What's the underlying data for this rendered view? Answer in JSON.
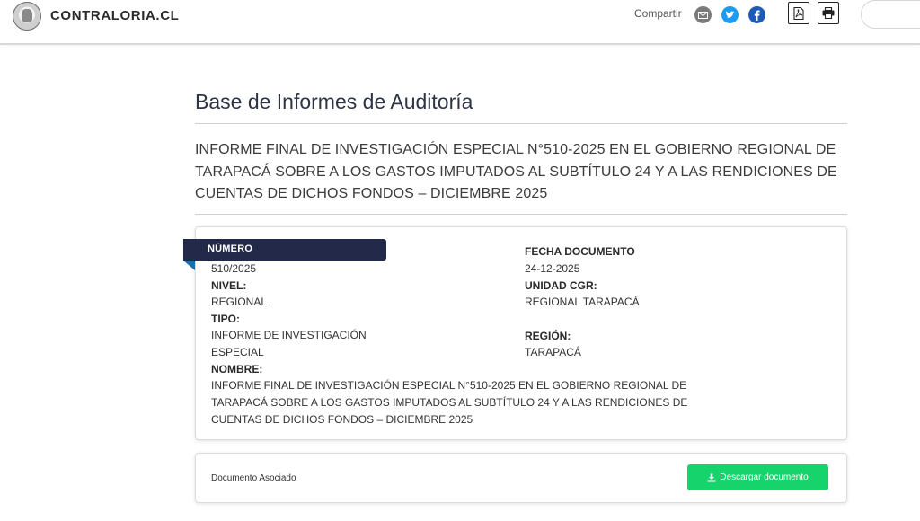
{
  "header": {
    "logo_text": "CONTRALORIA.CL",
    "share_label": "Compartir",
    "share_icons": [
      "mail-icon",
      "twitter-icon",
      "facebook-icon"
    ],
    "tool_icons": [
      "pdf-icon",
      "print-icon"
    ]
  },
  "page": {
    "title": "Base de Informes de Auditoría",
    "report_title": "INFORME FINAL DE INVESTIGACIÓN ESPECIAL N°510-2025 EN EL GOBIERNO REGIONAL DE TARAPACÁ SOBRE A LOS GASTOS IMPUTADOS AL SUBTÍTULO 24 Y A LAS RENDICIONES DE CUENTAS DE DICHOS FONDOS – DICIEMBRE 2025"
  },
  "details": {
    "numero_label": "NÚMERO",
    "numero_value": "510/2025",
    "fecha_label": "FECHA DOCUMENTO",
    "fecha_value": "24-12-2025",
    "nivel_label": "NIVEL:",
    "nivel_value": "REGIONAL",
    "unidad_label": "UNIDAD CGR:",
    "unidad_value": "REGIONAL TARAPACÁ",
    "tipo_label": "TIPO:",
    "tipo_value_line1": "INFORME DE INVESTIGACIÓN",
    "tipo_value_line2": "ESPECIAL",
    "region_label": "REGIÓN:",
    "region_value": "TARAPACÁ",
    "nombre_label": "NOMBRE:",
    "nombre_line1": "INFORME FINAL DE INVESTIGACIÓN ESPECIAL N°510-2025 EN EL GOBIERNO REGIONAL DE",
    "nombre_line2": "TARAPACÁ SOBRE A LOS GASTOS IMPUTADOS AL SUBTÍTULO 24 Y A LAS RENDICIONES DE",
    "nombre_line3": "CUENTAS DE DICHOS FONDOS – DICIEMBRE 2025"
  },
  "document": {
    "label": "Documento Asociado",
    "download_label": "Descargar documento"
  },
  "colors": {
    "ribbon": "#232a49",
    "download": "#17d36b",
    "twitter": "#1d9bf0",
    "facebook": "#1e5bb8"
  }
}
